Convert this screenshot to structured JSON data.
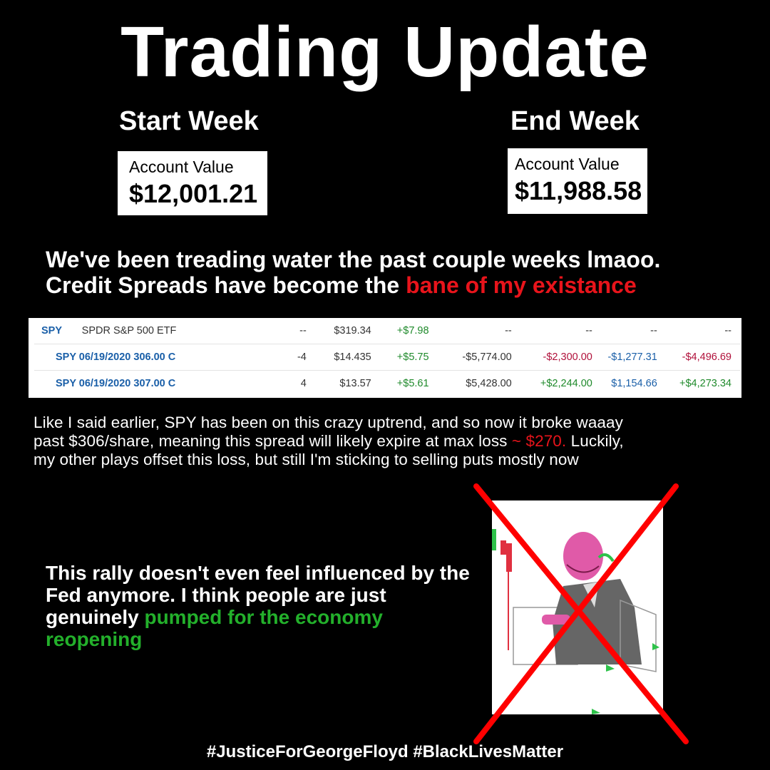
{
  "title": "Trading Update",
  "start_week": {
    "label": "Start Week",
    "account_label": "Account Value",
    "account_value": "$12,001.21"
  },
  "end_week": {
    "label": "End Week",
    "account_label": "Account Value",
    "account_value": "$11,988.58"
  },
  "intro": {
    "line1": "We've been treading water the past couple weeks lmaoo.",
    "line2_prefix": "Credit Spreads have become the ",
    "line2_highlight": "bane of my existance"
  },
  "positions_table": {
    "rows": [
      {
        "symbol": "SPY",
        "description": "SPDR S&P 500 ETF",
        "qty": "--",
        "price": "$319.34",
        "change": "+$7.98",
        "value": "--",
        "gain": "--",
        "day_gain": "--",
        "total": "--"
      },
      {
        "symbol": "SPY 06/19/2020 306.00 C",
        "description": "",
        "qty": "-4",
        "price": "$14.435",
        "change": "+$5.75",
        "value": "-$5,774.00",
        "gain": "-$2,300.00",
        "day_gain": "-$1,277.31",
        "total": "-$4,496.69"
      },
      {
        "symbol": "SPY 06/19/2020 307.00 C",
        "description": "",
        "qty": "4",
        "price": "$13.57",
        "change": "+$5.61",
        "value": "$5,428.00",
        "gain": "+$2,244.00",
        "day_gain": "$1,154.66",
        "total": "+$4,273.34"
      }
    ]
  },
  "commentary": {
    "line1": "Like I said earlier, SPY has been on this crazy uptrend, and so now it broke waaay",
    "line2_prefix": "past $306/share, meaning this spread will likely expire at max loss ",
    "line2_highlight": "~ $270.",
    "line2_suffix": " Luckily,",
    "line3": "my other plays offset this loss, but still I'm sticking to selling puts mostly now"
  },
  "rally_note": {
    "text_prefix": "This rally doesn't even feel influenced by the Fed anymore. I think people are just genuinely ",
    "highlight": "pumped for the economy reopening"
  },
  "meme_image": {
    "icon": "crossed-out-wojak-image"
  },
  "hashtags": "#JusticeForGeorgeFloyd #BlackLivesMatter",
  "colors": {
    "background": "#000000",
    "text": "#ffffff",
    "red_highlight": "#e8141b",
    "green_highlight": "#23b02b",
    "cross": "#ff0000"
  }
}
